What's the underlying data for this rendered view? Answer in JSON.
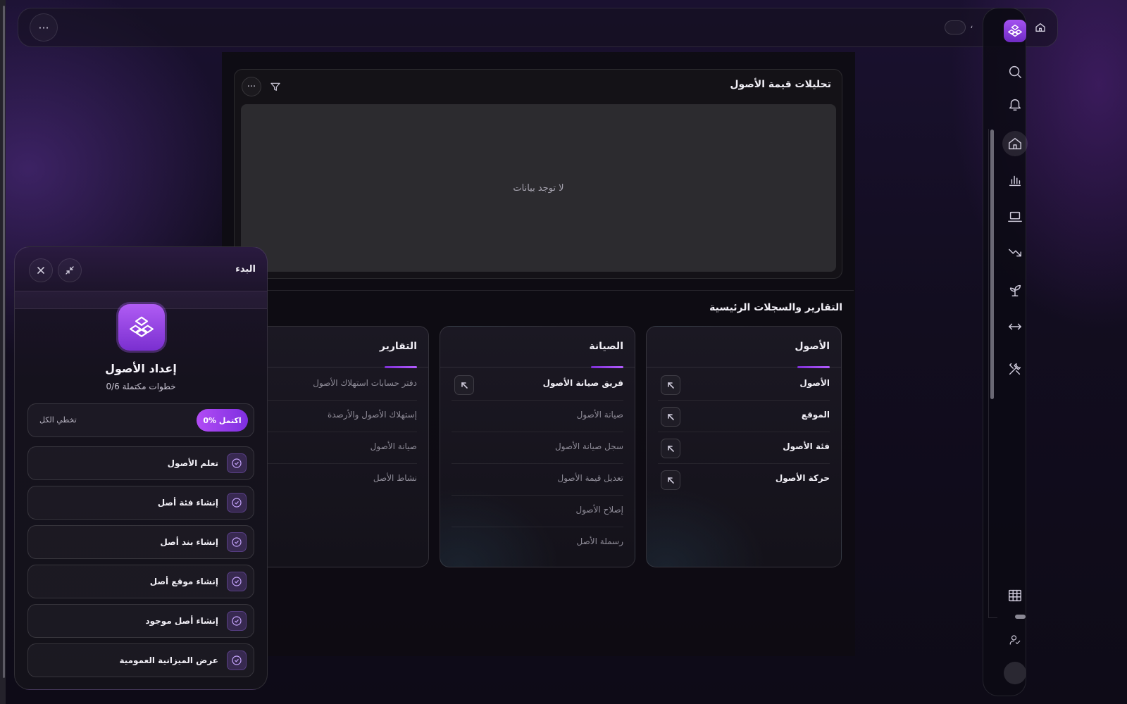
{
  "topbar": {
    "more_label": "···",
    "dot": "،",
    "crumb_separator": "/"
  },
  "rail": {
    "brand_icon": "assets-logo-icon",
    "items": [
      "search-icon",
      "bell-icon",
      "home-icon",
      "bar-chart-icon",
      "laptop-icon",
      "trend-down-icon",
      "sprout-icon",
      "arrows-horizontal-icon",
      "tools-icon",
      "table-icon",
      "user-check-icon"
    ],
    "active": "home-icon"
  },
  "analytics": {
    "title": "تحليلات قيمة الأصول",
    "empty_message": "لا توجد بيانات",
    "more_label": "···"
  },
  "section": {
    "title": "التقارير والسجلات الرئيسية"
  },
  "cards": {
    "assets": {
      "title": "الأصول",
      "items": [
        "الأصول",
        "الموقع",
        "فئة الأصول",
        "حركة الأصول"
      ]
    },
    "maintenance": {
      "title": "الصيانة",
      "items": [
        "فريق صيانة الأصول",
        "صيانة الأصول",
        "سجل صيانة الأصول",
        "تعديل قيمة الأصول",
        "إصلاح الأصول",
        "رسملة الأصل"
      ]
    },
    "reports": {
      "title": "التقارير",
      "items": [
        "دفتر حسابات استهلاك الأصول",
        "إستهلاك الأصول والأرصدة",
        "صيانة الأصول",
        "نشاط الأصل"
      ]
    }
  },
  "onboarding": {
    "title": "البدء",
    "heading": "إعداد الأصول",
    "steps_count": "0/6 خطوات مكتملة",
    "progress_label": "0% اكتمل",
    "progress_value": 0,
    "skip_label": "تخطي الكل",
    "steps": [
      "تعلم الأصول",
      "إنشاء فئة أصل",
      "إنشاء بند أصل",
      "إنشاء موقع أصل",
      "إنشاء أصل موجود",
      "عرض الميزانية العمومية"
    ]
  },
  "colors": {
    "accent": "#a24cf0",
    "accent_dark": "#7a2fd0",
    "background": "#120d1f"
  }
}
